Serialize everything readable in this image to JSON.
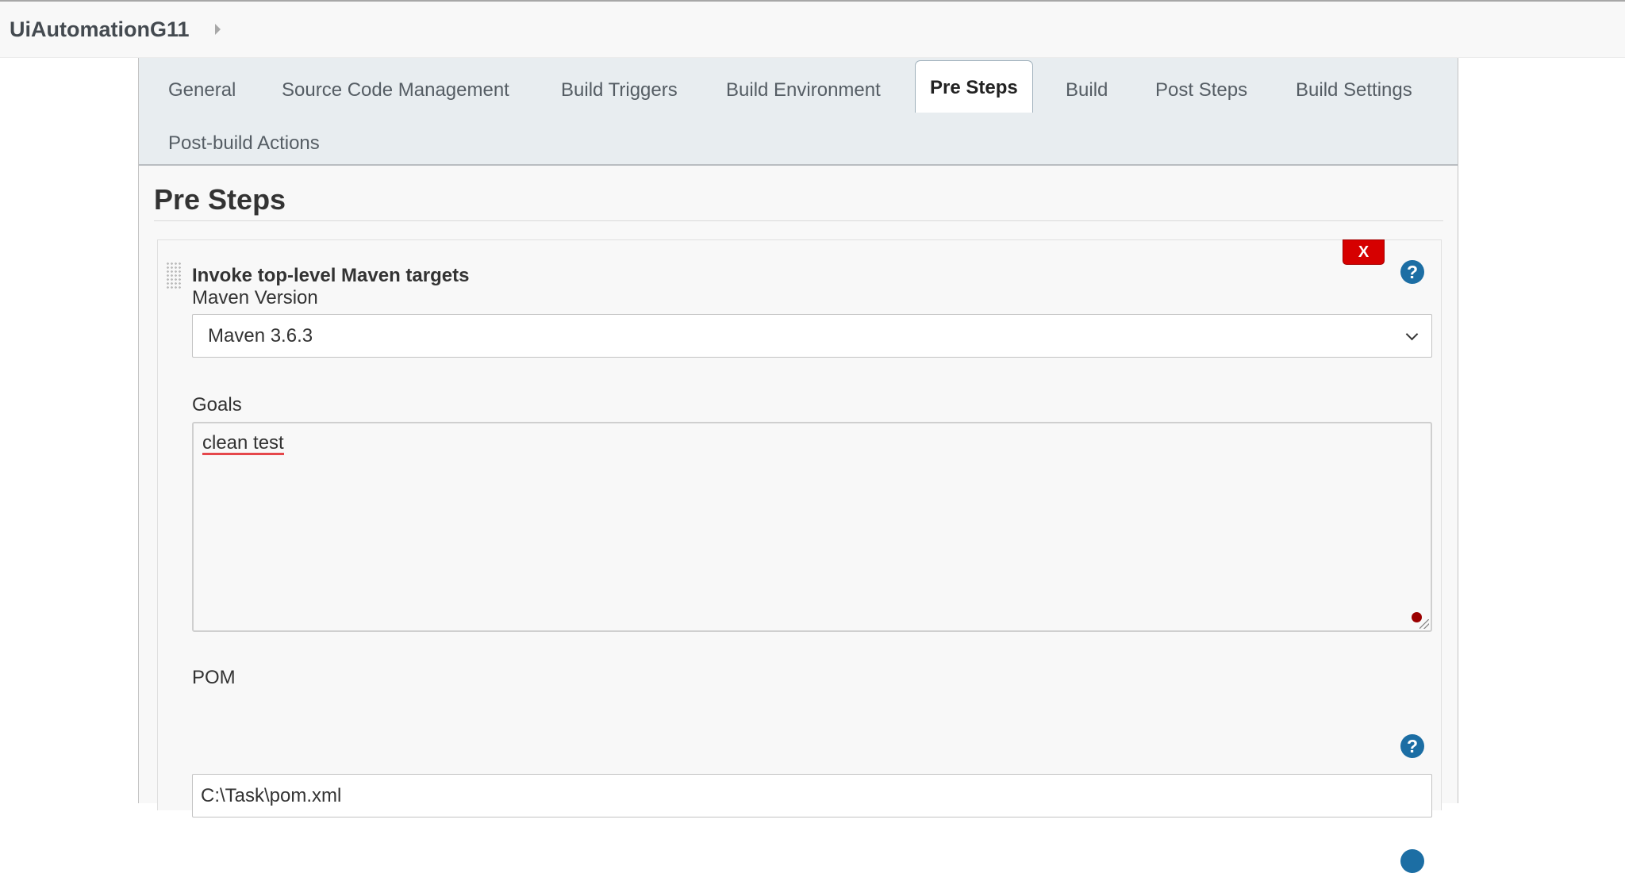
{
  "breadcrumb": {
    "job_name": "UiAutomationG11"
  },
  "tabs": [
    {
      "label": "General"
    },
    {
      "label": "Source Code Management"
    },
    {
      "label": "Build Triggers"
    },
    {
      "label": "Build Environment"
    },
    {
      "label": "Pre Steps",
      "active": true
    },
    {
      "label": "Build"
    },
    {
      "label": "Post Steps"
    },
    {
      "label": "Build Settings"
    },
    {
      "label": "Post-build Actions"
    }
  ],
  "section": {
    "title": "Pre Steps"
  },
  "step": {
    "title": "Invoke top-level Maven targets",
    "delete_label": "X",
    "help_label": "?",
    "maven_version": {
      "label": "Maven Version",
      "selected": "Maven 3.6.3"
    },
    "goals": {
      "label": "Goals",
      "value": "clean test"
    },
    "pom": {
      "label": "POM",
      "value": "C:\\Task\\pom.xml",
      "help_label": "?"
    }
  },
  "colors": {
    "tabbar_bg": "#e8edf0",
    "help_icon": "#1c6ea4",
    "delete_button": "#d60000",
    "spell_error": "#e5474b"
  }
}
